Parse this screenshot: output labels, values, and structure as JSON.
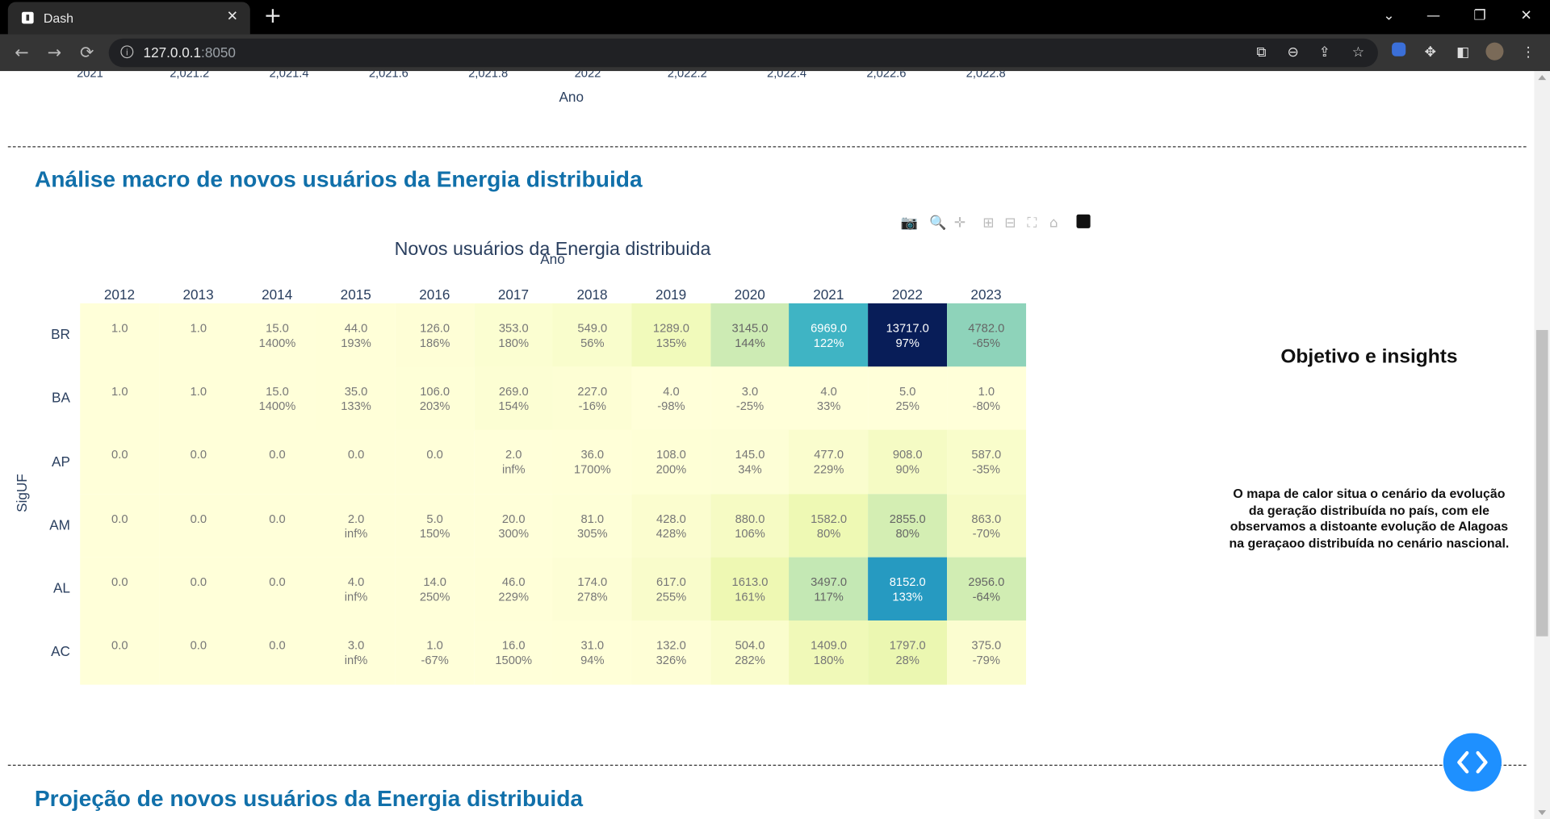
{
  "browser": {
    "tab_title": "Dash",
    "tab_close": "✕",
    "new_tab": "+",
    "url_host": "127.0.0.1",
    "url_port": ":8050",
    "window_controls": [
      "⌄",
      "—",
      "❐",
      "✕"
    ]
  },
  "previous_chart": {
    "x_ticks": [
      "2021",
      "2,021.2",
      "2,021.4",
      "2,021.6",
      "2,021.8",
      "2022",
      "2,022.2",
      "2,022.4",
      "2,022.6",
      "2,022.8"
    ],
    "x_label": "Ano"
  },
  "section1": {
    "title": "Análise macro de novos usuários da Energia distribuida"
  },
  "chart_data": {
    "type": "heatmap",
    "title": "Novos usuários da Energia distribuida",
    "xlabel": "Ano",
    "ylabel": "SigUF",
    "x": [
      "2012",
      "2013",
      "2014",
      "2015",
      "2016",
      "2017",
      "2018",
      "2019",
      "2020",
      "2021",
      "2022",
      "2023"
    ],
    "y": [
      "BR",
      "BA",
      "AP",
      "AM",
      "AL",
      "AC"
    ],
    "values": [
      [
        1.0,
        1.0,
        15.0,
        44.0,
        126.0,
        353.0,
        549.0,
        1289.0,
        3145.0,
        6969.0,
        13717.0,
        4782.0
      ],
      [
        1.0,
        1.0,
        15.0,
        35.0,
        106.0,
        269.0,
        227.0,
        4.0,
        3.0,
        4.0,
        5.0,
        1.0
      ],
      [
        0.0,
        0.0,
        0.0,
        0.0,
        0.0,
        2.0,
        36.0,
        108.0,
        145.0,
        477.0,
        908.0,
        587.0
      ],
      [
        0.0,
        0.0,
        0.0,
        2.0,
        5.0,
        20.0,
        81.0,
        428.0,
        880.0,
        1582.0,
        2855.0,
        863.0
      ],
      [
        0.0,
        0.0,
        0.0,
        4.0,
        14.0,
        46.0,
        174.0,
        617.0,
        1613.0,
        3497.0,
        8152.0,
        2956.0
      ],
      [
        0.0,
        0.0,
        0.0,
        3.0,
        1.0,
        16.0,
        31.0,
        132.0,
        504.0,
        1409.0,
        1797.0,
        375.0
      ]
    ],
    "labels": [
      [
        "1.0",
        "1.0",
        "15.0",
        "44.0",
        "126.0",
        "353.0",
        "549.0",
        "1289.0",
        "3145.0",
        "6969.0",
        "13717.0",
        "4782.0"
      ],
      [
        "1.0",
        "1.0",
        "15.0",
        "35.0",
        "106.0",
        "269.0",
        "227.0",
        "4.0",
        "3.0",
        "4.0",
        "5.0",
        "1.0"
      ],
      [
        "0.0",
        "0.0",
        "0.0",
        "0.0",
        "0.0",
        "2.0",
        "36.0",
        "108.0",
        "145.0",
        "477.0",
        "908.0",
        "587.0"
      ],
      [
        "0.0",
        "0.0",
        "0.0",
        "2.0",
        "5.0",
        "20.0",
        "81.0",
        "428.0",
        "880.0",
        "1582.0",
        "2855.0",
        "863.0"
      ],
      [
        "0.0",
        "0.0",
        "0.0",
        "4.0",
        "14.0",
        "46.0",
        "174.0",
        "617.0",
        "1613.0",
        "3497.0",
        "8152.0",
        "2956.0"
      ],
      [
        "0.0",
        "0.0",
        "0.0",
        "3.0",
        "1.0",
        "16.0",
        "31.0",
        "132.0",
        "504.0",
        "1409.0",
        "1797.0",
        "375.0"
      ]
    ],
    "growth": [
      [
        "",
        "",
        "1400%",
        "193%",
        "186%",
        "180%",
        "56%",
        "135%",
        "144%",
        "122%",
        "97%",
        "-65%"
      ],
      [
        "",
        "",
        "1400%",
        "133%",
        "203%",
        "154%",
        "-16%",
        "-98%",
        "-25%",
        "33%",
        "25%",
        "-80%"
      ],
      [
        "",
        "",
        "",
        "",
        "",
        "inf%",
        "1700%",
        "200%",
        "34%",
        "229%",
        "90%",
        "-35%"
      ],
      [
        "",
        "",
        "",
        "inf%",
        "150%",
        "300%",
        "305%",
        "428%",
        "106%",
        "80%",
        "80%",
        "-70%"
      ],
      [
        "",
        "",
        "",
        "inf%",
        "250%",
        "229%",
        "278%",
        "255%",
        "161%",
        "117%",
        "133%",
        "-64%"
      ],
      [
        "",
        "",
        "",
        "inf%",
        "-67%",
        "1500%",
        "94%",
        "326%",
        "282%",
        "180%",
        "28%",
        "-79%"
      ]
    ],
    "colorscale": "YlGnBu",
    "zrange": [
      0,
      13717
    ]
  },
  "modebar_icons": [
    "camera-icon",
    "zoom-icon",
    "pan-icon",
    "zoom-in-icon",
    "zoom-out-icon",
    "autoscale-icon",
    "reset-axes-icon",
    "plotly-logo"
  ],
  "insights": {
    "title": "Objetivo e insights",
    "text": "O mapa de calor situa o cenário da evolução da geração distribuída no país, com ele observamos a distoante evolução de Alagoas na geraçaoo distribuída no cenário nascional."
  },
  "section2": {
    "title": "Projeção de novos usuários da Energia distribuida"
  }
}
